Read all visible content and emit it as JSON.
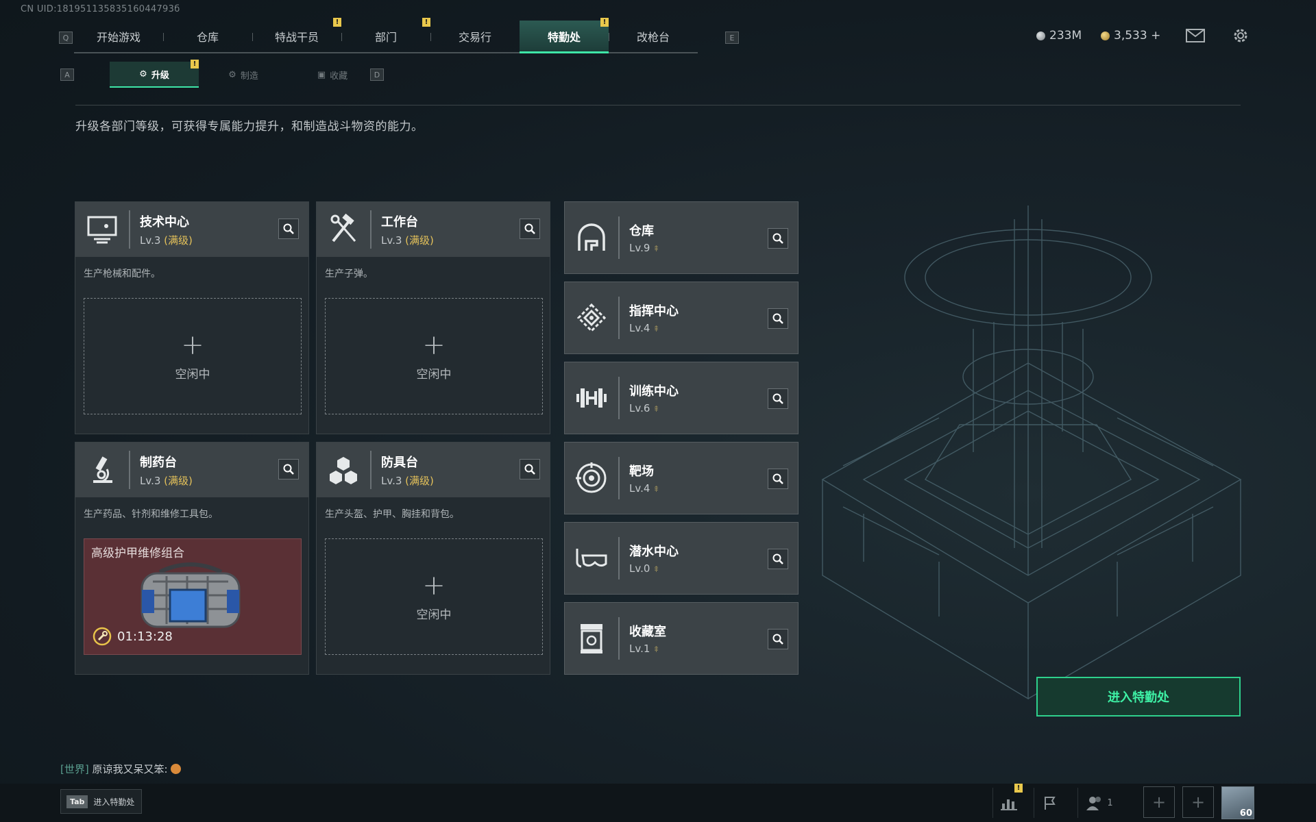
{
  "uid": "CN UID:18195113583516044793б",
  "nav": {
    "left_key": "Q",
    "right_key": "E",
    "tabs": [
      {
        "label": "开始游戏",
        "warn": false
      },
      {
        "label": "仓库",
        "warn": false
      },
      {
        "label": "特战干员",
        "warn": true
      },
      {
        "label": "部门",
        "warn": true
      },
      {
        "label": "交易行",
        "warn": false
      },
      {
        "label": "特勤处",
        "warn": true,
        "active": true
      },
      {
        "label": "改枪台",
        "warn": false
      }
    ],
    "warn_glyph": "!"
  },
  "currency": {
    "silver": "233M",
    "gold": "3,533 +"
  },
  "subtabs": {
    "left_key": "A",
    "right_key": "D",
    "items": [
      {
        "label": "升级",
        "active": true,
        "warn": true
      },
      {
        "label": "制造",
        "active": false
      },
      {
        "label": "收藏",
        "active": false
      }
    ]
  },
  "description": "升级各部门等级，可获得专属能力提升，和制造战斗物资的能力。",
  "cards": [
    {
      "title": "技术中心",
      "level": "Lv.3",
      "max": "(满级)",
      "desc": "生产枪械和配件。",
      "state": "空闲中"
    },
    {
      "title": "工作台",
      "level": "Lv.3",
      "max": "(满级)",
      "desc": "生产子弹。",
      "state": "空闲中"
    },
    {
      "title": "制药台",
      "level": "Lv.3",
      "max": "(满级)",
      "desc": "生产药品、针剂和维修工具包。",
      "craft_item": "高级护甲维修组合",
      "craft_time": "01:13:28"
    },
    {
      "title": "防具台",
      "level": "Lv.3",
      "max": "(满级)",
      "desc": "生产头盔、护甲、胸挂和背包。",
      "state": "空闲中"
    }
  ],
  "plus": "+",
  "small_cards": [
    {
      "title": "仓库",
      "level": "Lv.9"
    },
    {
      "title": "指挥中心",
      "level": "Lv.4"
    },
    {
      "title": "训练中心",
      "level": "Lv.6"
    },
    {
      "title": "靶场",
      "level": "Lv.4"
    },
    {
      "title": "潜水中心",
      "level": "Lv.0"
    },
    {
      "title": "收藏室",
      "level": "Lv.1"
    }
  ],
  "enter_button": "进入特勤处",
  "chat": {
    "channel": "[世界]",
    "message": "原谅我又呆又笨:"
  },
  "bottom": {
    "tab_key": "Tab",
    "tab_label": "进入特勤处",
    "friends_count": "1",
    "avatar_level": "60"
  }
}
